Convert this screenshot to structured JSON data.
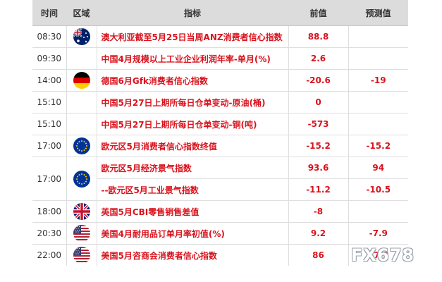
{
  "header": {
    "time": "时间",
    "region": "区域",
    "indicator": "指标",
    "previous": "前值",
    "forecast": "预测值"
  },
  "rows": [
    {
      "time": "08:30",
      "flag": "australia-flag-icon",
      "indicator": "澳大利亚截至5月25日当周ANZ消费者信心指数",
      "previous": "88.8",
      "forecast": ""
    },
    {
      "time": "09:30",
      "flag": "",
      "indicator": "中国4月规模以上工业企业利润年率-单月(%)",
      "previous": "2.6",
      "forecast": ""
    },
    {
      "time": "14:00",
      "flag": "germany-flag-icon",
      "indicator": "德国6月Gfk消费者信心指数",
      "previous": "-20.6",
      "forecast": "-19"
    },
    {
      "time": "15:10",
      "flag": "",
      "indicator": "中国5月27日上期所每日仓单变动-原油(桶)",
      "previous": "0",
      "forecast": ""
    },
    {
      "time": "15:10",
      "flag": "",
      "indicator": "中国5月27日上期所每日仓单变动-铜(吨)",
      "previous": "-573",
      "forecast": ""
    },
    {
      "time": "17:00",
      "flag": "eu-flag-icon",
      "indicator": "欧元区5月消费者信心指数终值",
      "previous": "-15.2",
      "forecast": "-15.2"
    },
    {
      "time": "17:00",
      "flag": "eu-flag-icon",
      "indicator": "欧元区5月经济景气指数",
      "previous": "93.6",
      "forecast": "94"
    },
    {
      "time": "",
      "flag": "",
      "indicator": "--欧元区5月工业景气指数",
      "previous": "-11.2",
      "forecast": "-10.5"
    },
    {
      "time": "18:00",
      "flag": "uk-flag-icon",
      "indicator": "英国5月CBI零售销售差值",
      "previous": "-8",
      "forecast": ""
    },
    {
      "time": "20:30",
      "flag": "usa-flag-icon",
      "indicator": "美国4月耐用品订单月率初值(%)",
      "previous": "9.2",
      "forecast": "-7.9"
    },
    {
      "time": "22:00",
      "flag": "usa-flag-icon",
      "indicator": "美国5月咨商会消费者信心指数",
      "previous": "86",
      "forecast": "87.2"
    }
  ],
  "watermark": "FX678",
  "colors": {
    "header_bg": "#dcdcdc",
    "value_red": "#d9131d"
  }
}
